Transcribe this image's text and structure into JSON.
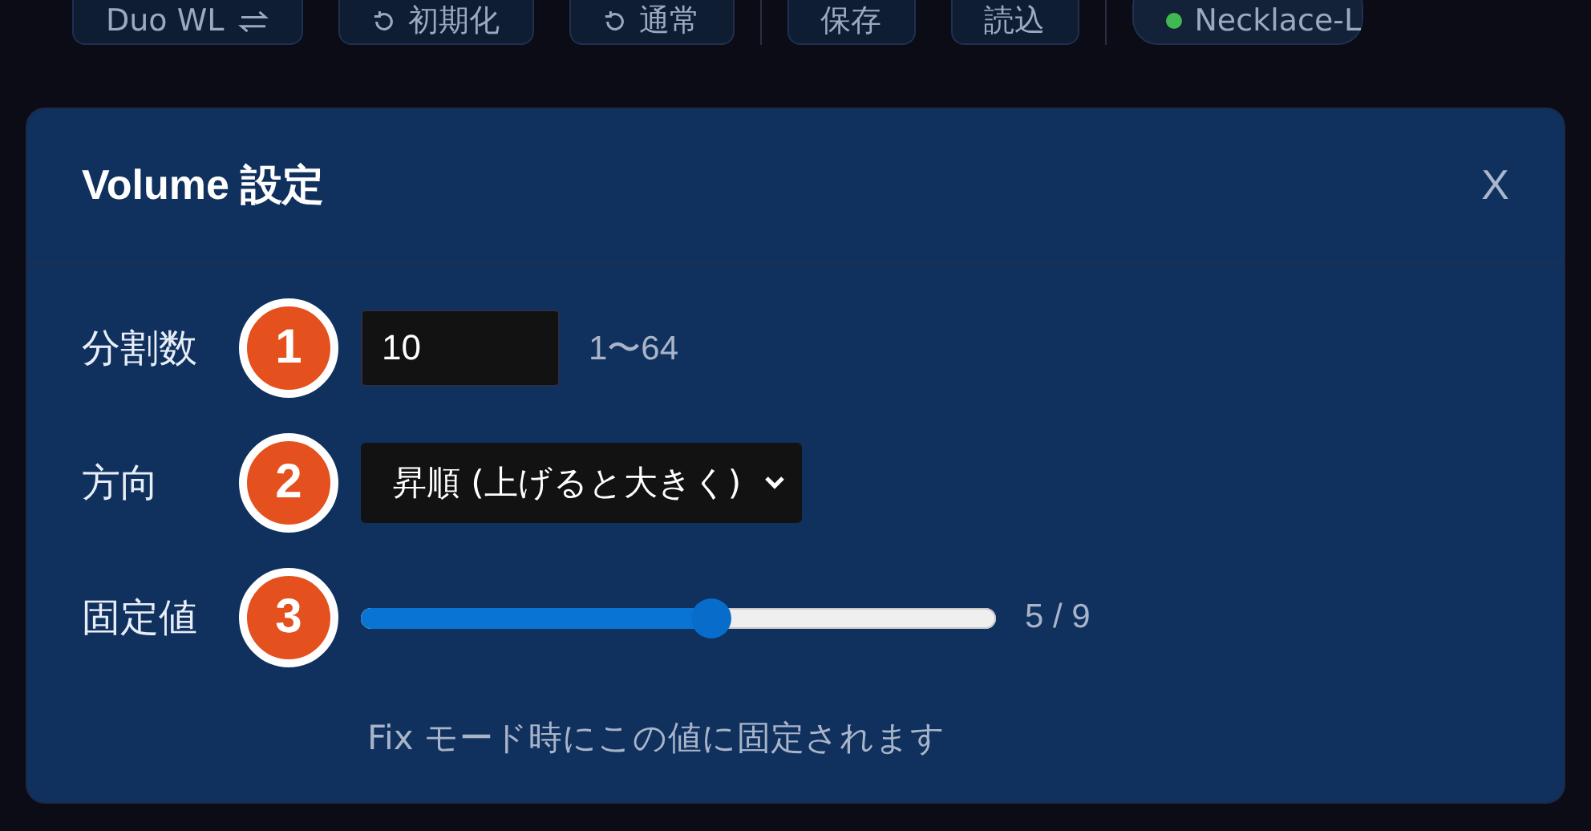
{
  "toolbar": {
    "groups": [
      {
        "buttons": [
          {
            "label": "Duo WL",
            "kind": "swap"
          },
          {
            "label": "初期化",
            "kind": "reset"
          },
          {
            "label": "通常",
            "kind": "reset"
          }
        ]
      },
      {
        "buttons": [
          {
            "label": "保存",
            "kind": "plain"
          },
          {
            "label": "読込",
            "kind": "plain"
          }
        ]
      },
      {
        "buttons": [
          {
            "label": "Necklace-L",
            "kind": "status"
          }
        ]
      }
    ]
  },
  "dialog": {
    "title": "Volume 設定",
    "close": "X",
    "fields": [
      {
        "label": "分割数",
        "step": "1",
        "kind": "number",
        "value": "10",
        "hint": "1〜64"
      },
      {
        "label": "方向",
        "step": "2",
        "kind": "select",
        "value": "昇順 (上げると大きく)"
      },
      {
        "label": "固定値",
        "step": "3",
        "kind": "slider",
        "level": 0.55,
        "reading": "5 / 9"
      }
    ],
    "note": "Fix モード時にこの値に固定されます"
  }
}
